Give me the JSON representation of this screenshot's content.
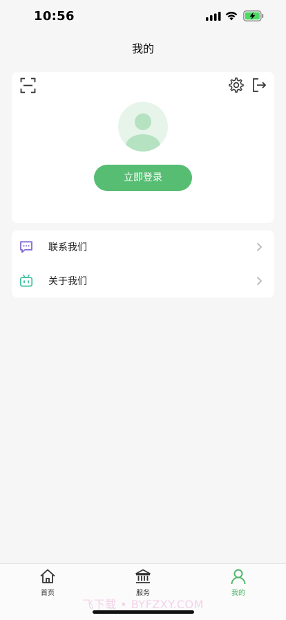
{
  "status_bar": {
    "time": "10:56"
  },
  "header": {
    "title": "我的"
  },
  "profile": {
    "login_label": "立即登录"
  },
  "menu": {
    "items": [
      {
        "label": "联系我们",
        "icon": "chat-icon",
        "color": "#7b61d6"
      },
      {
        "label": "关于我们",
        "icon": "robot-icon",
        "color": "#3cc0a0"
      }
    ]
  },
  "tabbar": {
    "items": [
      {
        "label": "首页",
        "icon": "home-icon",
        "active": false
      },
      {
        "label": "服务",
        "icon": "bank-icon",
        "active": false
      },
      {
        "label": "我的",
        "icon": "user-icon",
        "active": true
      }
    ]
  },
  "watermark": "飞下载 • BYFZXY.COM",
  "colors": {
    "accent": "#56bd72",
    "background": "#f6f6f7",
    "active_tab": "#4cb567"
  }
}
